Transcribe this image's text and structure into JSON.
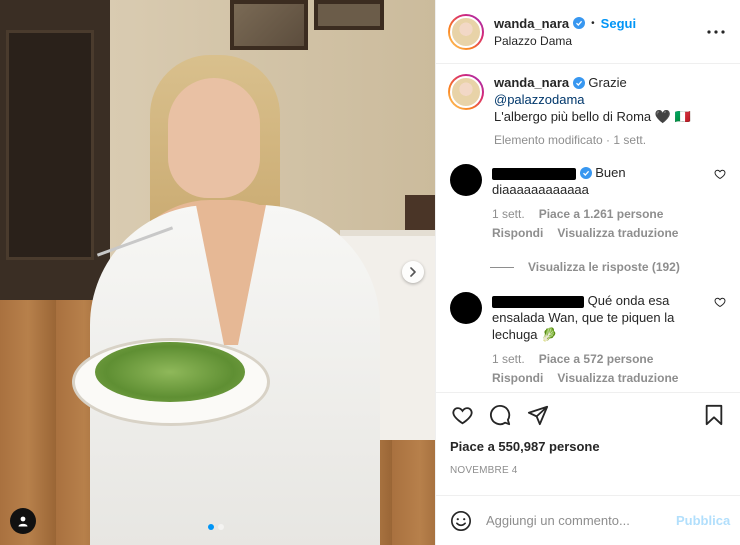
{
  "post": {
    "author": {
      "username": "wanda_nara",
      "verified": true,
      "follow_label": "Segui",
      "separator": "•",
      "location": "Palazzo Dama"
    },
    "media": {
      "carousel_total": 2,
      "carousel_active": 1
    },
    "caption": {
      "username": "wanda_nara",
      "text_1": "Grazie",
      "mention": "@palazzodama",
      "text_2": "L'albergo più bello di Roma 🖤 🇮🇹",
      "meta": "Elemento modificato · 1 sett."
    },
    "comments": [
      {
        "username_redacted": true,
        "verified": true,
        "text": "Buen diaaaaaaaaaaaa",
        "time": "1 sett.",
        "likes": "Piace a 1.261 persone",
        "reply_label": "Rispondi",
        "translate_label": "Visualizza traduzione",
        "view_replies": "Visualizza le risposte (192)"
      },
      {
        "username_redacted": true,
        "verified": false,
        "text": "Qué onda esa ensalada Wan, que te piquen la lechuga 🥬",
        "time": "1 sett.",
        "likes": "Piace a 572 persone",
        "reply_label": "Rispondi",
        "translate_label": "Visualizza traduzione"
      }
    ],
    "likes_total": "Piace a 550,987 persone",
    "date": "NOVEMBRE 4",
    "add_comment": {
      "placeholder": "Aggiungi un commento...",
      "publish_label": "Pubblica"
    }
  },
  "colors": {
    "accent": "#0095f6",
    "verified": "#3897f0",
    "mention": "#00376b",
    "muted": "#8e8e8e",
    "publish_disabled": "#b2dffc"
  },
  "icons": [
    "more-icon",
    "heart-icon",
    "comment-icon",
    "share-icon",
    "bookmark-icon",
    "emoji-icon",
    "chevron-right-icon",
    "user-tag-icon",
    "verified-icon"
  ]
}
